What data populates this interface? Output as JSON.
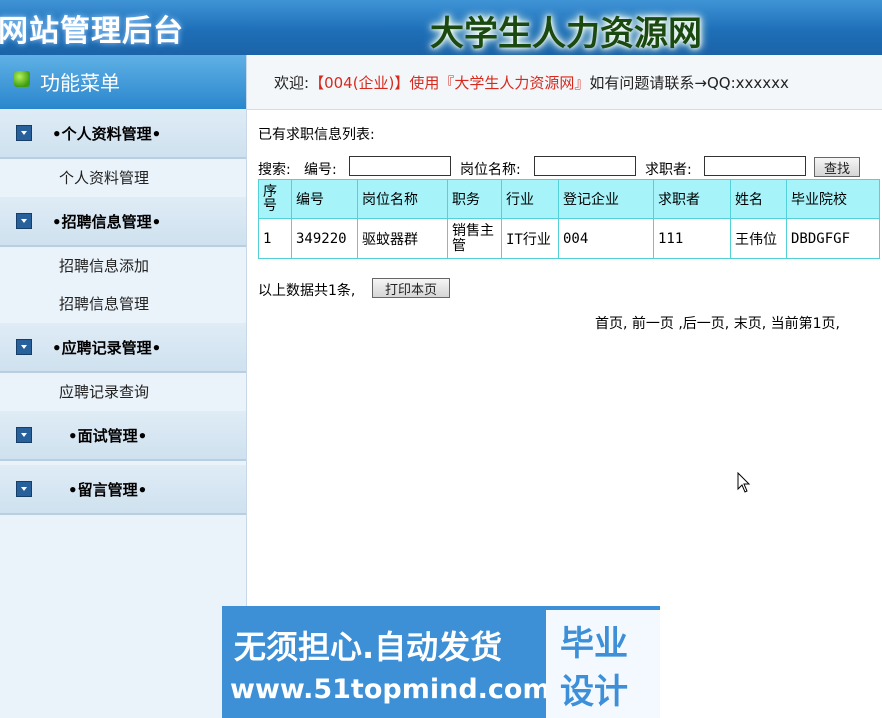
{
  "header": {
    "left_title": "网站管理后台",
    "right_title": "大学生人力资源网"
  },
  "sidebar": {
    "menu_title": "功能菜单",
    "groups": [
      {
        "label": "•个人资料管理•",
        "items": [
          "个人资料管理"
        ]
      },
      {
        "label": "•招聘信息管理•",
        "items": [
          "招聘信息添加",
          "招聘信息管理"
        ]
      },
      {
        "label": "•应聘记录管理•",
        "items": [
          "应聘记录查询"
        ]
      },
      {
        "label": "•面试管理•",
        "items": []
      },
      {
        "label": "•留言管理•",
        "items": []
      }
    ]
  },
  "welcome": {
    "prefix": "欢迎:",
    "highlight": "【004(企业)】使用『大学生人力资源网』",
    "suffix": "如有问题请联系→QQ:xxxxxx"
  },
  "list": {
    "title": "已有求职信息列表:",
    "search_label": "搜索:",
    "field1_label": "编号:",
    "field2_label": "岗位名称:",
    "field3_label": "求职者:",
    "field1_value": "",
    "field2_value": "",
    "field3_value": "",
    "search_button": "查找",
    "columns": [
      "序号",
      "编号",
      "岗位名称",
      "职务",
      "行业",
      "登记企业",
      "求职者",
      "姓名",
      "毕业院校"
    ],
    "rows": [
      [
        "1",
        "349220",
        "驱蚊器群",
        "销售主管",
        "IT行业",
        "004",
        "111",
        "王伟位",
        "DBDGFGF"
      ]
    ],
    "total_text": "以上数据共1条,",
    "print_button": "打印本页",
    "pager_text": "首页, 前一页 ,后一页, 末页, 当前第1页,"
  },
  "promo": {
    "line1": "无须担心.自动发货",
    "line2": "www.51topmind.com",
    "box_line1": "毕业",
    "box_line2": "设计"
  }
}
